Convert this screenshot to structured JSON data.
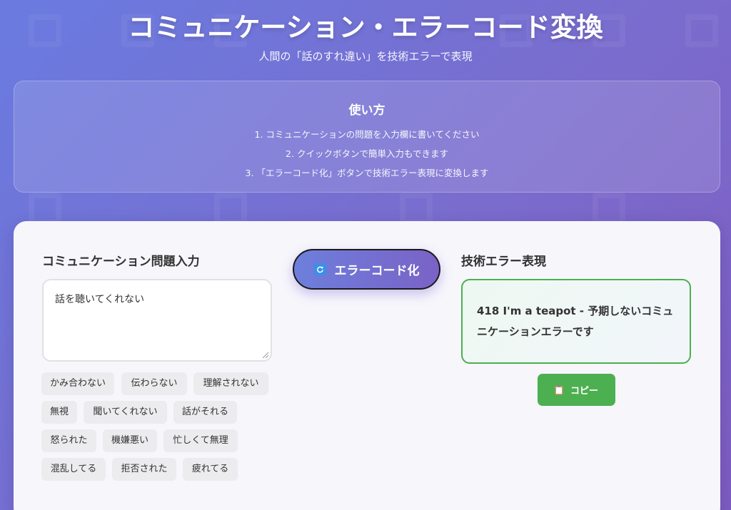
{
  "header": {
    "title": "コミュニケーション・エラーコード変換",
    "subtitle": "人間の「話のすれ違い」を技術エラーで表現"
  },
  "howto": {
    "title": "使い方",
    "steps": [
      "1. コミュニケーションの問題を入力欄に書いてください",
      "2. クイックボタンで簡単入力もできます",
      "3. 「エラーコード化」ボタンで技術エラー表現に変換します"
    ]
  },
  "input_section": {
    "label": "コミュニケーション問題入力",
    "value": "話を聴いてくれない"
  },
  "quick_buttons": [
    "かみ合わない",
    "伝わらない",
    "理解されない",
    "無視",
    "聞いてくれない",
    "話がそれる",
    "怒られた",
    "機嫌悪い",
    "忙しくて無理",
    "混乱してる",
    "拒否された",
    "疲れてる"
  ],
  "convert_button": {
    "label": "エラーコード化",
    "icon": "refresh-icon"
  },
  "output_section": {
    "label": "技術エラー表現",
    "result": "418 I'm a teapot - 予期しないコミュニケーションエラーです"
  },
  "copy_button": {
    "label": "コピー",
    "icon": "clipboard-icon"
  },
  "colors": {
    "background_start": "#6a7be0",
    "background_end": "#7e5cc0",
    "success_green": "#4caf50",
    "card_bg": "#f7f6fb"
  }
}
